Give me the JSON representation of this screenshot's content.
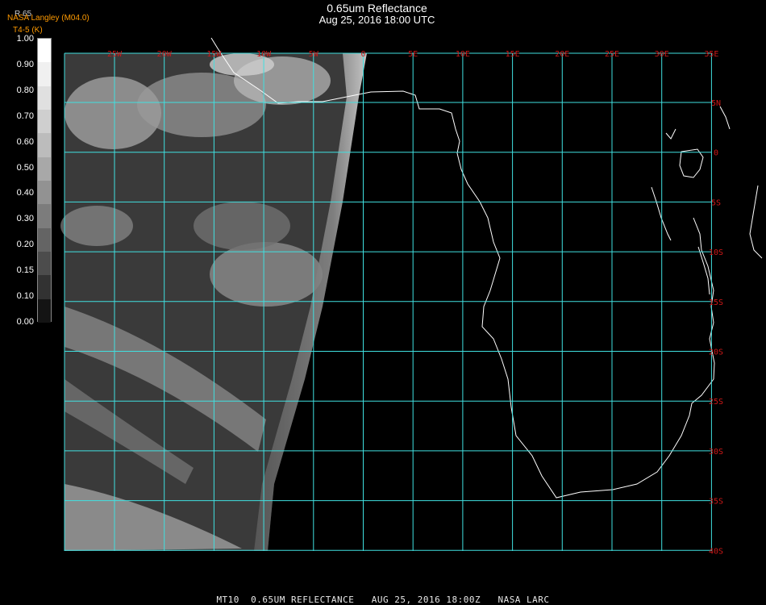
{
  "header": {
    "title": "0.65um Reflectance",
    "datetime": "Aug 25, 2016 18:00 UTC",
    "credit": "NASA Langley (M04.0)",
    "product": "T4-5 (K)",
    "colorbar_ticker": "R 65"
  },
  "colorbar": {
    "labels": [
      "1.00",
      "0.90",
      "0.80",
      "0.70",
      "0.60",
      "0.50",
      "0.40",
      "0.30",
      "0.20",
      "0.15",
      "0.10",
      "0.00"
    ]
  },
  "grid": {
    "lon_labels": [
      "25W",
      "20W",
      "15W",
      "10W",
      "5W",
      "0",
      "5E",
      "10E",
      "15E",
      "20E",
      "25E",
      "30E",
      "35E"
    ],
    "lat_labels": [
      "5N",
      "0",
      "5S",
      "10S",
      "15S",
      "20S",
      "25S",
      "30S",
      "35S",
      "40S"
    ],
    "line_color": "#40e0e0",
    "label_color": "#d01818"
  },
  "footer": "MT10  0.65UM REFLECTANCE   AUG 25, 2016 18:00Z   NASA LARC"
}
